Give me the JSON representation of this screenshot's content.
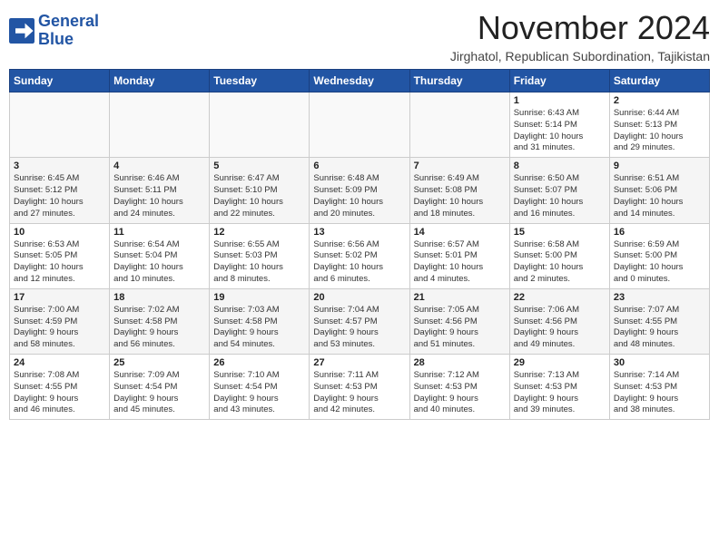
{
  "header": {
    "logo_line1": "General",
    "logo_line2": "Blue",
    "month": "November 2024",
    "location": "Jirghatol, Republican Subordination, Tajikistan"
  },
  "weekdays": [
    "Sunday",
    "Monday",
    "Tuesday",
    "Wednesday",
    "Thursday",
    "Friday",
    "Saturday"
  ],
  "weeks": [
    [
      {
        "day": "",
        "info": ""
      },
      {
        "day": "",
        "info": ""
      },
      {
        "day": "",
        "info": ""
      },
      {
        "day": "",
        "info": ""
      },
      {
        "day": "",
        "info": ""
      },
      {
        "day": "1",
        "info": "Sunrise: 6:43 AM\nSunset: 5:14 PM\nDaylight: 10 hours\nand 31 minutes."
      },
      {
        "day": "2",
        "info": "Sunrise: 6:44 AM\nSunset: 5:13 PM\nDaylight: 10 hours\nand 29 minutes."
      }
    ],
    [
      {
        "day": "3",
        "info": "Sunrise: 6:45 AM\nSunset: 5:12 PM\nDaylight: 10 hours\nand 27 minutes."
      },
      {
        "day": "4",
        "info": "Sunrise: 6:46 AM\nSunset: 5:11 PM\nDaylight: 10 hours\nand 24 minutes."
      },
      {
        "day": "5",
        "info": "Sunrise: 6:47 AM\nSunset: 5:10 PM\nDaylight: 10 hours\nand 22 minutes."
      },
      {
        "day": "6",
        "info": "Sunrise: 6:48 AM\nSunset: 5:09 PM\nDaylight: 10 hours\nand 20 minutes."
      },
      {
        "day": "7",
        "info": "Sunrise: 6:49 AM\nSunset: 5:08 PM\nDaylight: 10 hours\nand 18 minutes."
      },
      {
        "day": "8",
        "info": "Sunrise: 6:50 AM\nSunset: 5:07 PM\nDaylight: 10 hours\nand 16 minutes."
      },
      {
        "day": "9",
        "info": "Sunrise: 6:51 AM\nSunset: 5:06 PM\nDaylight: 10 hours\nand 14 minutes."
      }
    ],
    [
      {
        "day": "10",
        "info": "Sunrise: 6:53 AM\nSunset: 5:05 PM\nDaylight: 10 hours\nand 12 minutes."
      },
      {
        "day": "11",
        "info": "Sunrise: 6:54 AM\nSunset: 5:04 PM\nDaylight: 10 hours\nand 10 minutes."
      },
      {
        "day": "12",
        "info": "Sunrise: 6:55 AM\nSunset: 5:03 PM\nDaylight: 10 hours\nand 8 minutes."
      },
      {
        "day": "13",
        "info": "Sunrise: 6:56 AM\nSunset: 5:02 PM\nDaylight: 10 hours\nand 6 minutes."
      },
      {
        "day": "14",
        "info": "Sunrise: 6:57 AM\nSunset: 5:01 PM\nDaylight: 10 hours\nand 4 minutes."
      },
      {
        "day": "15",
        "info": "Sunrise: 6:58 AM\nSunset: 5:00 PM\nDaylight: 10 hours\nand 2 minutes."
      },
      {
        "day": "16",
        "info": "Sunrise: 6:59 AM\nSunset: 5:00 PM\nDaylight: 10 hours\nand 0 minutes."
      }
    ],
    [
      {
        "day": "17",
        "info": "Sunrise: 7:00 AM\nSunset: 4:59 PM\nDaylight: 9 hours\nand 58 minutes."
      },
      {
        "day": "18",
        "info": "Sunrise: 7:02 AM\nSunset: 4:58 PM\nDaylight: 9 hours\nand 56 minutes."
      },
      {
        "day": "19",
        "info": "Sunrise: 7:03 AM\nSunset: 4:58 PM\nDaylight: 9 hours\nand 54 minutes."
      },
      {
        "day": "20",
        "info": "Sunrise: 7:04 AM\nSunset: 4:57 PM\nDaylight: 9 hours\nand 53 minutes."
      },
      {
        "day": "21",
        "info": "Sunrise: 7:05 AM\nSunset: 4:56 PM\nDaylight: 9 hours\nand 51 minutes."
      },
      {
        "day": "22",
        "info": "Sunrise: 7:06 AM\nSunset: 4:56 PM\nDaylight: 9 hours\nand 49 minutes."
      },
      {
        "day": "23",
        "info": "Sunrise: 7:07 AM\nSunset: 4:55 PM\nDaylight: 9 hours\nand 48 minutes."
      }
    ],
    [
      {
        "day": "24",
        "info": "Sunrise: 7:08 AM\nSunset: 4:55 PM\nDaylight: 9 hours\nand 46 minutes."
      },
      {
        "day": "25",
        "info": "Sunrise: 7:09 AM\nSunset: 4:54 PM\nDaylight: 9 hours\nand 45 minutes."
      },
      {
        "day": "26",
        "info": "Sunrise: 7:10 AM\nSunset: 4:54 PM\nDaylight: 9 hours\nand 43 minutes."
      },
      {
        "day": "27",
        "info": "Sunrise: 7:11 AM\nSunset: 4:53 PM\nDaylight: 9 hours\nand 42 minutes."
      },
      {
        "day": "28",
        "info": "Sunrise: 7:12 AM\nSunset: 4:53 PM\nDaylight: 9 hours\nand 40 minutes."
      },
      {
        "day": "29",
        "info": "Sunrise: 7:13 AM\nSunset: 4:53 PM\nDaylight: 9 hours\nand 39 minutes."
      },
      {
        "day": "30",
        "info": "Sunrise: 7:14 AM\nSunset: 4:53 PM\nDaylight: 9 hours\nand 38 minutes."
      }
    ]
  ]
}
